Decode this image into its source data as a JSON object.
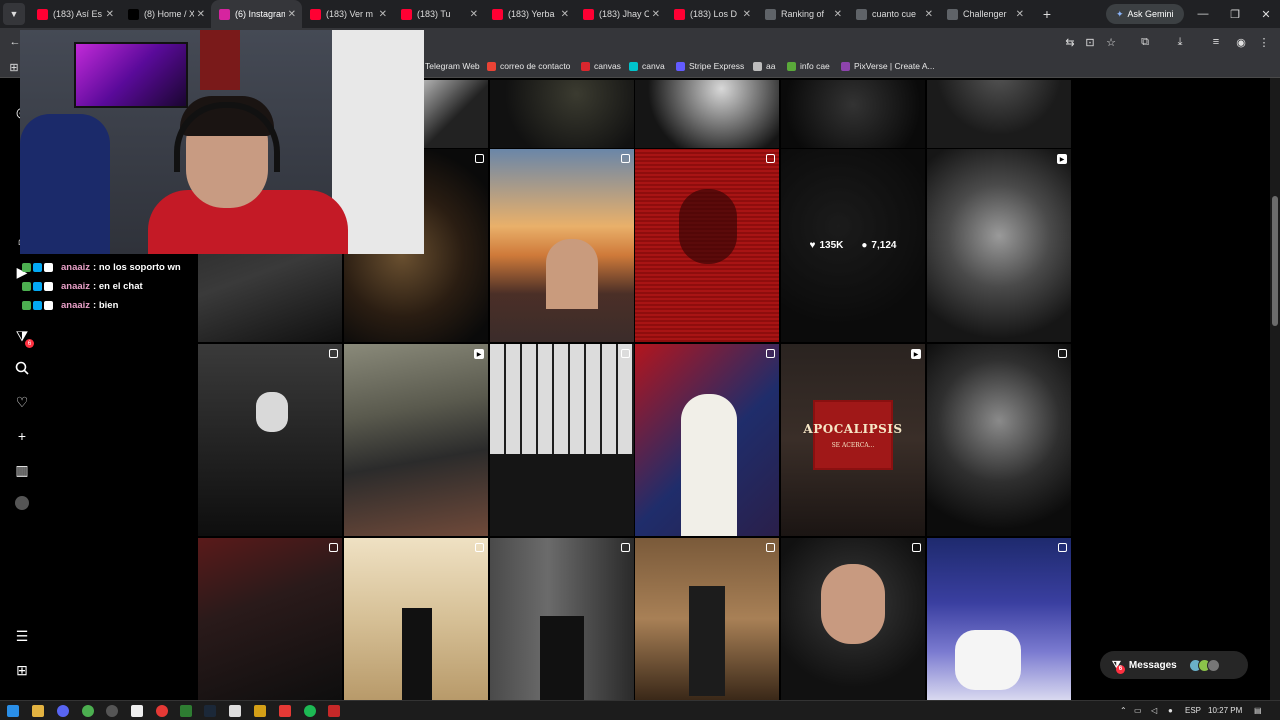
{
  "browser": {
    "tabs": [
      {
        "label": "(183) Así Es",
        "favicon": "youtube-icon",
        "color": "#ff0033",
        "active": false
      },
      {
        "label": "(8) Home / X",
        "favicon": "x-icon",
        "color": "#000000",
        "active": false
      },
      {
        "label": "(6) Instagram",
        "favicon": "instagram-icon",
        "color": "#d6249f",
        "active": true
      },
      {
        "label": "(183) Ver m",
        "favicon": "youtube-icon",
        "color": "#ff0033",
        "active": false
      },
      {
        "label": "(183) Tu",
        "favicon": "youtube-icon",
        "color": "#ff0033",
        "active": false
      },
      {
        "label": "(183) Yerba",
        "favicon": "youtube-icon",
        "color": "#ff0033",
        "active": false
      },
      {
        "label": "(183) Jhay C",
        "favicon": "youtube-icon",
        "color": "#ff0033",
        "active": false
      },
      {
        "label": "(183) Los D",
        "favicon": "youtube-icon",
        "color": "#ff0033",
        "active": false
      },
      {
        "label": "Ranking of",
        "favicon": "diamond-icon",
        "color": "#ffffff",
        "active": false
      },
      {
        "label": "cuanto cue",
        "favicon": "google-icon",
        "color": "#ffffff",
        "active": false
      },
      {
        "label": "Challenger",
        "favicon": "chevron-icon",
        "color": "#ffffff",
        "active": false
      }
    ],
    "new_tab": "+",
    "gemini_label": "Ask Gemini",
    "bookmarks": [
      {
        "label": "Telegram Web",
        "color": "#2aa3df"
      },
      {
        "label": "correo de contacto",
        "color": "#ea4335"
      },
      {
        "label": "canvas",
        "color": "#d9272e"
      },
      {
        "label": "canva",
        "color": "#00c4cc"
      },
      {
        "label": "Stripe Express",
        "color": "#635bff"
      },
      {
        "label": "aa",
        "color": "#bdbdbd"
      },
      {
        "label": "info cae",
        "color": "#5aa93a"
      },
      {
        "label": "PixVerse | Create A...",
        "color": "#8e44ad"
      }
    ]
  },
  "stream": {
    "chat": [
      {
        "user": "anaaiz",
        "message": ": no los soporto wn"
      },
      {
        "user": "anaaiz",
        "message": ": en el chat"
      },
      {
        "user": "anaaiz",
        "message": ": bien"
      }
    ]
  },
  "instagram": {
    "hover_stats": {
      "likes": "135K",
      "comments": "7,124"
    },
    "poster": {
      "title": "APOCALIPSIS",
      "subtitle": "SE ACERCA..."
    },
    "messages_label": "Messages",
    "messages_badge": "6",
    "notif_badge": "6",
    "colors": {
      "badge": "#ff3040",
      "pill": "#262626"
    }
  },
  "taskbar": {
    "language": "ESP",
    "time": "10:27 PM"
  }
}
